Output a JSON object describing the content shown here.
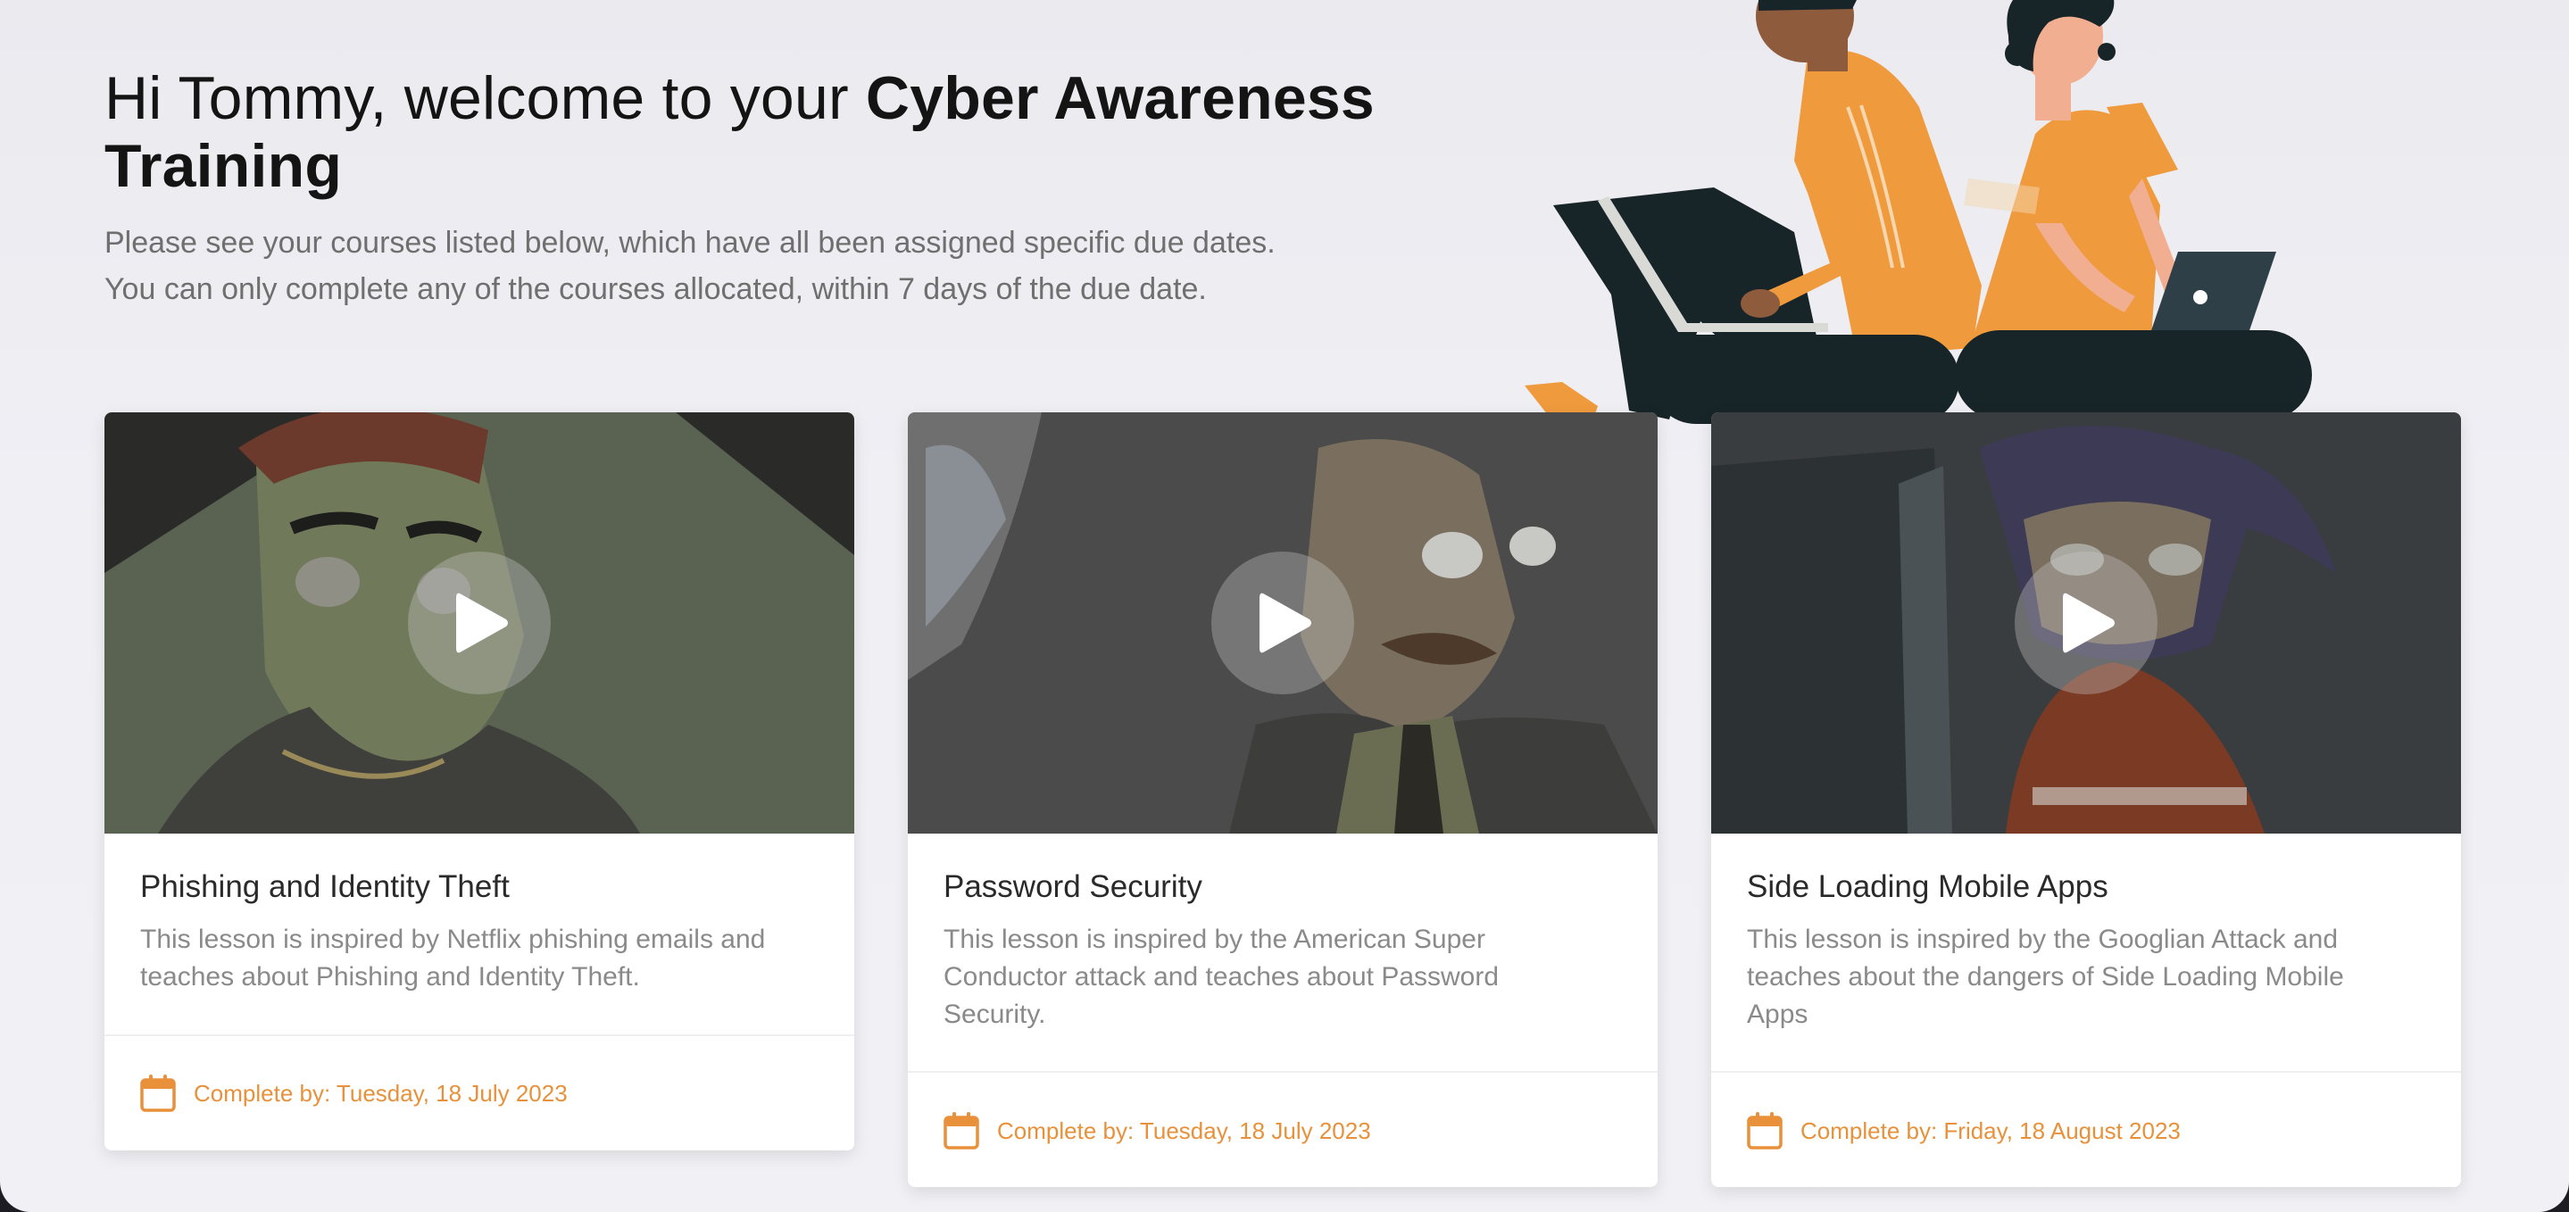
{
  "header": {
    "title_lead": "Hi Tommy, welcome to your ",
    "title_bold": "Cyber Awareness Training",
    "subtitle_lines": [
      "Please see your courses listed below, which have all been assigned specific due dates.",
      "You can only complete any of the courses allocated, within 7 days of the due date."
    ]
  },
  "theme": {
    "accent": "#e8913a",
    "page_background": "#efeff4",
    "card_background": "#ffffff",
    "title_color": "#141414",
    "muted_text": "#8a8a8a"
  },
  "courses": [
    {
      "title": "Phishing and Identity Theft",
      "description": "This lesson is inspired by Netflix phishing emails and teaches about Phishing and Identity Theft.",
      "due_label": "Complete by: Tuesday, 18 July 2023",
      "icon": "calendar-icon"
    },
    {
      "title": "Password Security",
      "description": "This lesson is inspired by the American Super Conductor attack and teaches about Password Security.",
      "due_label": "Complete by: Tuesday, 18 July 2023",
      "icon": "calendar-icon"
    },
    {
      "title": "Side Loading Mobile Apps",
      "description": "This lesson is inspired by the Googlian Attack and teaches about the dangers of Side Loading Mobile Apps",
      "due_label": "Complete by: Friday, 18 August 2023",
      "icon": "calendar-icon"
    }
  ],
  "icons": {
    "play": "play-icon",
    "calendar": "calendar-icon"
  }
}
